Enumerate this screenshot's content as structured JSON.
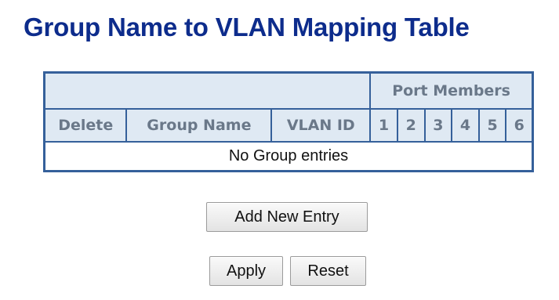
{
  "page": {
    "title": "Group Name to VLAN Mapping Table"
  },
  "table": {
    "group_header": "Port Members",
    "columns": {
      "delete": "Delete",
      "group_name": "Group Name",
      "vlan_id": "VLAN ID"
    },
    "ports": [
      "1",
      "2",
      "3",
      "4",
      "5",
      "6"
    ],
    "empty_message": "No Group entries"
  },
  "buttons": {
    "add_new_entry": "Add New Entry",
    "apply": "Apply",
    "reset": "Reset"
  },
  "colors": {
    "title": "#0d2c8c",
    "table_border": "#35609a",
    "header_background": "#dfe9f3",
    "header_text": "#6a7889"
  }
}
